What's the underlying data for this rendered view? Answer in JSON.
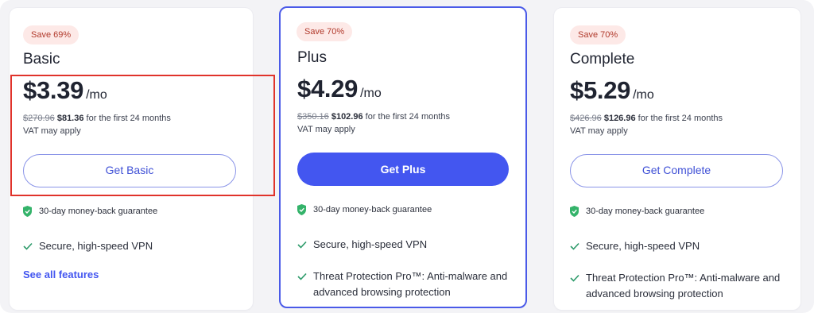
{
  "plans": [
    {
      "badge": "Save 69%",
      "name": "Basic",
      "price": "$3.39",
      "period": "/mo",
      "old_price": "$270.96",
      "new_price": "$81.36",
      "price_note": "for the first 24 months",
      "vat": "VAT may apply",
      "button": "Get Basic",
      "guarantee": "30-day money-back guarantee",
      "features": [
        "Secure, high-speed VPN"
      ],
      "link": "See all features"
    },
    {
      "badge": "Save 70%",
      "name": "Plus",
      "price": "$4.29",
      "period": "/mo",
      "old_price": "$350.16",
      "new_price": "$102.96",
      "price_note": "for the first 24 months",
      "vat": "VAT may apply",
      "button": "Get Plus",
      "guarantee": "30-day money-back guarantee",
      "features": [
        "Secure, high-speed VPN",
        "Threat Protection Pro™: Anti-malware and advanced browsing protection"
      ]
    },
    {
      "badge": "Save 70%",
      "name": "Complete",
      "price": "$5.29",
      "period": "/mo",
      "old_price": "$426.96",
      "new_price": "$126.96",
      "price_note": "for the first 24 months",
      "vat": "VAT may apply",
      "button": "Get Complete",
      "guarantee": "30-day money-back guarantee",
      "features": [
        "Secure, high-speed VPN",
        "Threat Protection Pro™: Anti-malware and advanced browsing protection"
      ]
    }
  ],
  "colors": {
    "accent": "#4356f0",
    "badge_bg": "#fde9e7",
    "badge_text": "#b13a2c",
    "check": "#2e9b6b",
    "shield": "#34b36a",
    "highlight": "#e0332b"
  },
  "icons": {
    "guarantee": "shield-check-icon",
    "feature": "checkmark-icon"
  }
}
